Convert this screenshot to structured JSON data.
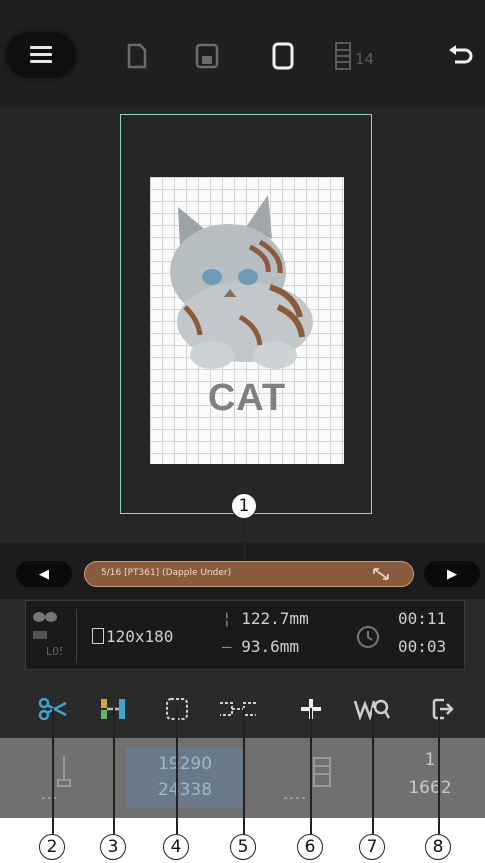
{
  "toolbar": {
    "icons": [
      "menu-icon",
      "new-file-icon",
      "save-icon",
      "hoop-frame-icon",
      "thread-spool-icon",
      "undo-icon"
    ],
    "spool_count": "14"
  },
  "design": {
    "text": "CAT",
    "fabric_color": "#fafafa",
    "hoop_color": "#8fd2c9"
  },
  "color_bar": {
    "label": "5/16 [PT361] (Dapple Under)",
    "pill_color": "#8a5a3c"
  },
  "info": {
    "hoop_size": "120x180",
    "height": "122.7mm",
    "width": "93.6mm",
    "time_total": "00:11",
    "time_remaining": "00:03"
  },
  "tools": [
    "thread-trim-icon",
    "color-sort-icon",
    "basting-frame-icon",
    "appliqué-jump-icon",
    "move-cross-icon",
    "color-search-icon",
    "exit-icon"
  ],
  "bottom": {
    "stitch_current": "19290",
    "stitch_total": "24338",
    "stop_number": "1",
    "stop_total": "1662"
  },
  "callouts": [
    "1",
    "2",
    "3",
    "4",
    "5",
    "6",
    "7",
    "8"
  ],
  "accent": "#3fa5cf"
}
